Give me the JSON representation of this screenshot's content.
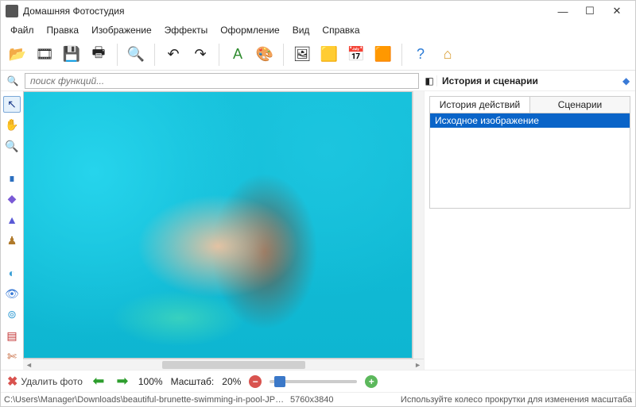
{
  "window": {
    "title": "Домашняя Фотостудия"
  },
  "menu": [
    "Файл",
    "Правка",
    "Изображение",
    "Эффекты",
    "Оформление",
    "Вид",
    "Справка"
  ],
  "toolbar": [
    {
      "name": "open-icon",
      "glyph": "📂"
    },
    {
      "name": "effects-wheel-icon",
      "glyph": "🎞"
    },
    {
      "name": "save-icon",
      "glyph": "💾"
    },
    {
      "name": "print-icon",
      "glyph": "🖶"
    },
    {
      "name": "sep"
    },
    {
      "name": "search-page-icon",
      "glyph": "🔍"
    },
    {
      "name": "sep"
    },
    {
      "name": "undo-icon",
      "glyph": "↶"
    },
    {
      "name": "redo-icon",
      "glyph": "↷"
    },
    {
      "name": "sep"
    },
    {
      "name": "text-icon",
      "glyph": "A",
      "color": "#2e8b2e"
    },
    {
      "name": "palette-icon",
      "glyph": "🎨"
    },
    {
      "name": "sep"
    },
    {
      "name": "image-tool-icon",
      "glyph": "🖼"
    },
    {
      "name": "frame-icon",
      "glyph": "🟨"
    },
    {
      "name": "calendar-icon",
      "glyph": "📅"
    },
    {
      "name": "collage-icon",
      "glyph": "🟧"
    },
    {
      "name": "sep"
    },
    {
      "name": "help-icon",
      "glyph": "?",
      "color": "#2b7bd6"
    },
    {
      "name": "home-icon",
      "glyph": "⌂",
      "color": "#d89a2b"
    }
  ],
  "search": {
    "placeholder": "поиск функций..."
  },
  "right_panel": {
    "title": "История и сценарии",
    "tabs": [
      "История действий",
      "Сценарии"
    ],
    "active_tab": 0,
    "history": [
      "Исходное изображение"
    ]
  },
  "left_tools": [
    {
      "name": "pointer-icon",
      "glyph": "↖",
      "color": "#1a3a8a",
      "active": true
    },
    {
      "name": "hand-icon",
      "glyph": "✋",
      "color": "#999"
    },
    {
      "name": "zoom-icon",
      "glyph": "🔍",
      "color": "#3a7ad6"
    },
    {
      "name": "gap"
    },
    {
      "name": "brush-icon",
      "glyph": "∎",
      "color": "#2b6fbf"
    },
    {
      "name": "drop-icon",
      "glyph": "◆",
      "color": "#7a5ad6"
    },
    {
      "name": "shape-icon",
      "glyph": "▲",
      "color": "#5a5ad6"
    },
    {
      "name": "stamp-icon",
      "glyph": "♟",
      "color": "#b07a2b"
    },
    {
      "name": "gap"
    },
    {
      "name": "ellipse-icon",
      "glyph": "◐",
      "color": "#3aa0d6"
    },
    {
      "name": "eye-icon",
      "glyph": "👁",
      "color": "#3a7ad6"
    },
    {
      "name": "circle-icon",
      "glyph": "⊚",
      "color": "#3aa0d6"
    },
    {
      "name": "levels-icon",
      "glyph": "▤",
      "color": "#c03030"
    },
    {
      "name": "crop-icon",
      "glyph": "✄",
      "color": "#c05a2b"
    }
  ],
  "bottom": {
    "delete_label": "Удалить фото",
    "percent_label": "100%",
    "scale_label": "Масштаб:",
    "scale_value": "20%"
  },
  "status": {
    "path": "C:\\Users\\Manager\\Downloads\\beautiful-brunette-swimming-in-pool-JPRZEMB.jpg",
    "dims": "5760x3840",
    "hint": "Используйте колесо прокрутки для изменения масштаба"
  }
}
